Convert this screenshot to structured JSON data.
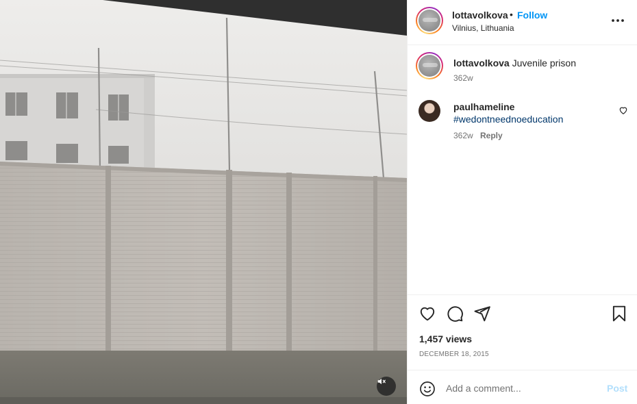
{
  "header": {
    "username": "lottavolkova",
    "separator": "•",
    "follow_label": "Follow",
    "location": "Vilnius, Lithuania",
    "more_icon": "more-horizontal-icon"
  },
  "caption": {
    "username": "lottavolkova",
    "text": "Juvenile prison",
    "time": "362w"
  },
  "comments": [
    {
      "username": "paulhameline",
      "hashtag": "#wedontneednoeducation",
      "time": "362w",
      "reply_label": "Reply",
      "like_icon": "heart-outline-icon"
    }
  ],
  "actions": {
    "like_icon": "heart-outline-icon",
    "comment_icon": "comment-icon",
    "share_icon": "paper-plane-icon",
    "save_icon": "bookmark-icon"
  },
  "stats": {
    "views": "1,457 views",
    "date": "DECEMBER 18, 2015"
  },
  "add_comment": {
    "placeholder": "Add a comment...",
    "post_label": "Post",
    "emoji_icon": "emoji-smile-icon"
  },
  "media": {
    "mute_icon": "speaker-muted-icon"
  },
  "colors": {
    "accent": "#0095f6",
    "post_disabled": "#b2dffc",
    "hashtag": "#00376b",
    "secondary_text": "#737373",
    "border": "#efefef"
  }
}
